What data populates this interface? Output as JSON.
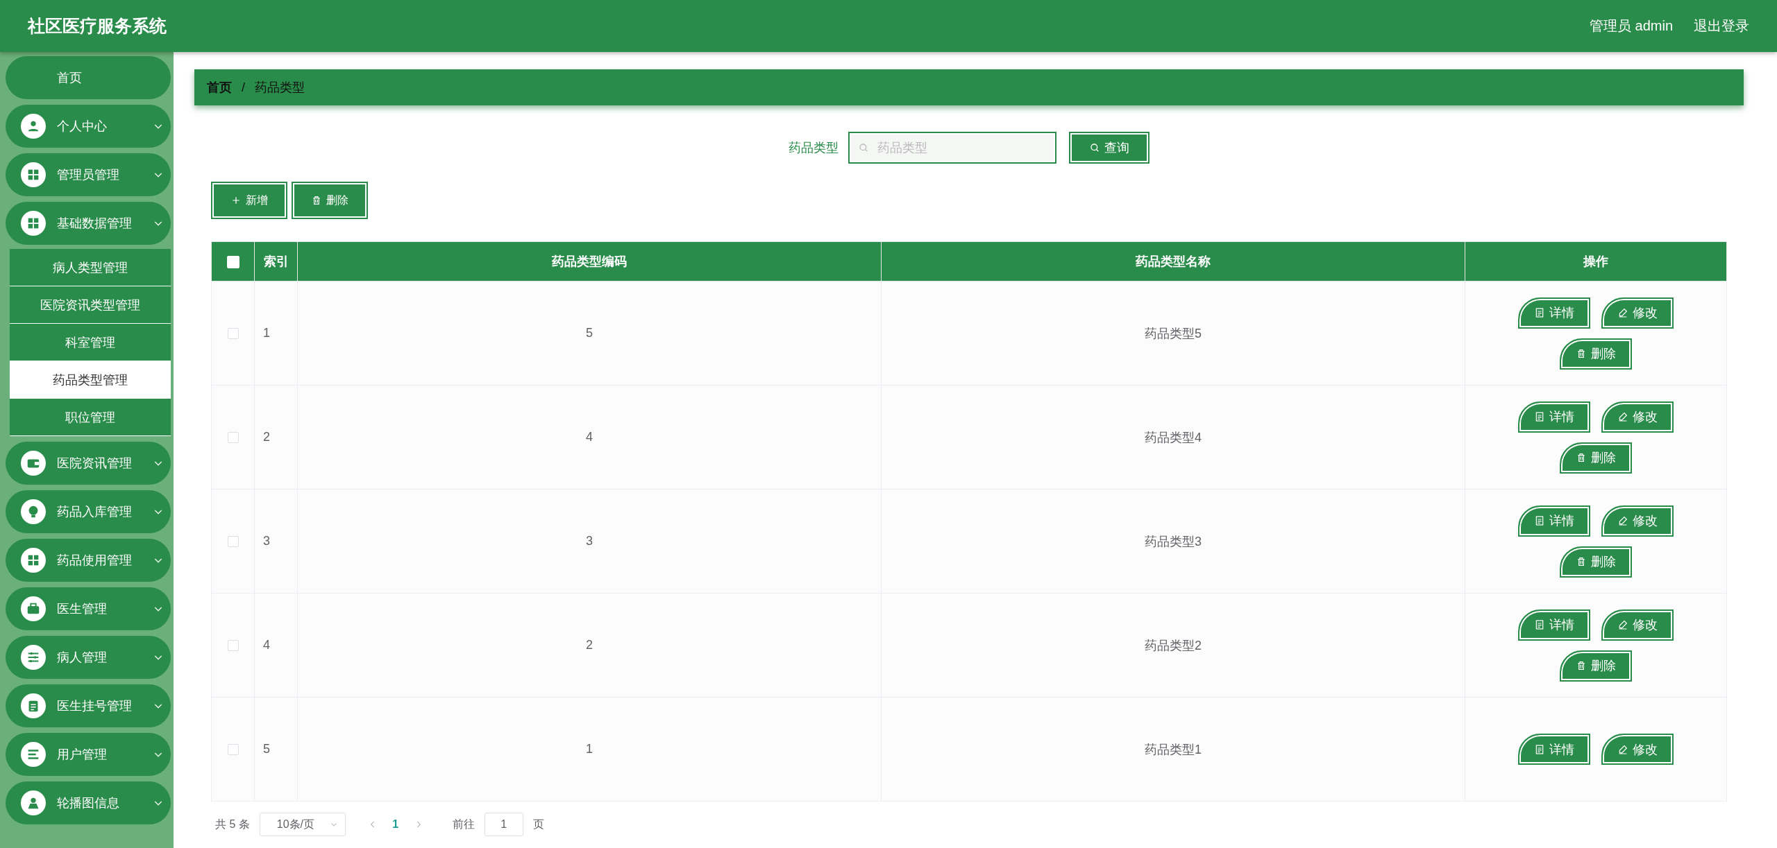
{
  "header": {
    "title": "社区医疗服务系统",
    "user": "管理员 admin",
    "logout": "退出登录"
  },
  "sidebar": {
    "items": [
      {
        "kind": "link",
        "label": "首页"
      },
      {
        "kind": "group",
        "label": "个人中心"
      },
      {
        "kind": "group",
        "label": "管理员管理"
      },
      {
        "kind": "group",
        "label": "基础数据管理",
        "expanded": true,
        "children": [
          {
            "label": "病人类型管理",
            "selected": false
          },
          {
            "label": "医院资讯类型管理",
            "selected": false
          },
          {
            "label": "科室管理",
            "selected": false
          },
          {
            "label": "药品类型管理",
            "selected": true
          },
          {
            "label": "职位管理",
            "selected": false
          }
        ]
      },
      {
        "kind": "group",
        "label": "医院资讯管理"
      },
      {
        "kind": "group",
        "label": "药品入库管理"
      },
      {
        "kind": "group",
        "label": "药品使用管理"
      },
      {
        "kind": "group",
        "label": "医生管理"
      },
      {
        "kind": "group",
        "label": "病人管理"
      },
      {
        "kind": "group",
        "label": "医生挂号管理"
      },
      {
        "kind": "group",
        "label": "用户管理"
      },
      {
        "kind": "group",
        "label": "轮播图信息"
      }
    ]
  },
  "breadcrumb": [
    {
      "label": "首页"
    },
    {
      "label": "/"
    },
    {
      "label": "药品类型"
    }
  ],
  "search": {
    "label": "药品类型",
    "placeholder": "药品类型",
    "button": "查询"
  },
  "toolbar": [
    {
      "kind": "add",
      "label": "新增"
    },
    {
      "kind": "delete",
      "label": "删除"
    }
  ],
  "table": {
    "select_all_checked": false,
    "columns": [
      "索引",
      "药品类型编码",
      "药品类型名称",
      "操作"
    ],
    "rows": [
      {
        "checked": false,
        "index": "1",
        "code": "5",
        "name": "药品类型5",
        "actions": [
          {
            "kind": "detail",
            "label": "详情"
          },
          {
            "kind": "edit",
            "label": "修改"
          },
          {
            "kind": "delete",
            "label": "删除"
          }
        ]
      },
      {
        "checked": false,
        "index": "2",
        "code": "4",
        "name": "药品类型4",
        "actions": [
          {
            "kind": "detail",
            "label": "详情"
          },
          {
            "kind": "edit",
            "label": "修改"
          },
          {
            "kind": "delete",
            "label": "删除"
          }
        ]
      },
      {
        "checked": false,
        "index": "3",
        "code": "3",
        "name": "药品类型3",
        "actions": [
          {
            "kind": "detail",
            "label": "详情"
          },
          {
            "kind": "edit",
            "label": "修改"
          },
          {
            "kind": "delete",
            "label": "删除"
          }
        ]
      },
      {
        "checked": false,
        "index": "4",
        "code": "2",
        "name": "药品类型2",
        "actions": [
          {
            "kind": "detail",
            "label": "详情"
          },
          {
            "kind": "edit",
            "label": "修改"
          },
          {
            "kind": "delete",
            "label": "删除"
          }
        ]
      },
      {
        "checked": false,
        "index": "5",
        "code": "1",
        "name": "药品类型1",
        "actions": [
          {
            "kind": "detail",
            "label": "详情"
          },
          {
            "kind": "edit",
            "label": "修改"
          }
        ]
      }
    ]
  },
  "pagination": {
    "total": "共 5 条",
    "page_size": "10条/页",
    "pages": [
      {
        "label": "1",
        "selected": true
      }
    ],
    "goto_label": "前往",
    "goto_value": "1",
    "goto_unit": "页"
  }
}
